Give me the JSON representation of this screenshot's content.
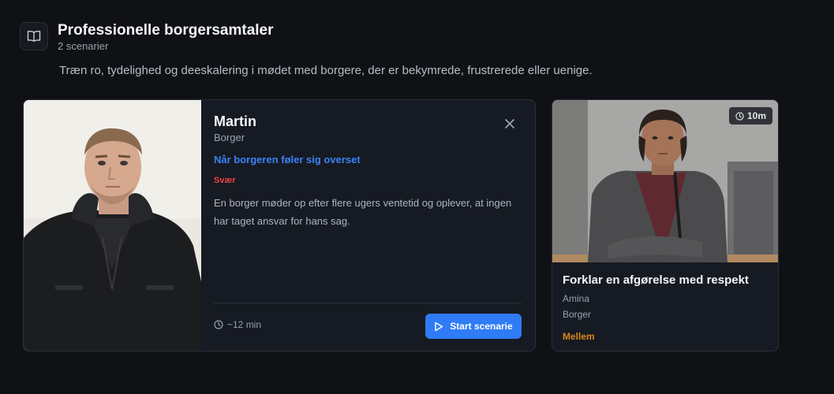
{
  "section": {
    "icon": "book-open-icon",
    "title": "Professionelle borgersamtaler",
    "count": "2 scenarier",
    "description": "Træn ro, tydelighed og deeskalering i mødet med borgere, der er bekymrede, frustrerede eller uenige."
  },
  "expanded_card": {
    "name": "Martin",
    "role": "Borger",
    "scenario_title": "Når borgeren føler sig overset",
    "difficulty": "Svær",
    "description": "En borger møder op efter flere ugers ventetid og oplever, at ingen har taget ansvar for hans sag.",
    "duration": "~12 min",
    "start_label": "Start scenarie",
    "colors": {
      "accent": "#2f7cf6",
      "link": "#3b82f6",
      "difficulty": "#ef4444"
    }
  },
  "scenario_card": {
    "duration_badge": "10m",
    "title": "Forklar en afgørelse med respekt",
    "name": "Amina",
    "role": "Borger",
    "difficulty": "Mellem",
    "colors": {
      "difficulty": "#d9861f"
    }
  }
}
